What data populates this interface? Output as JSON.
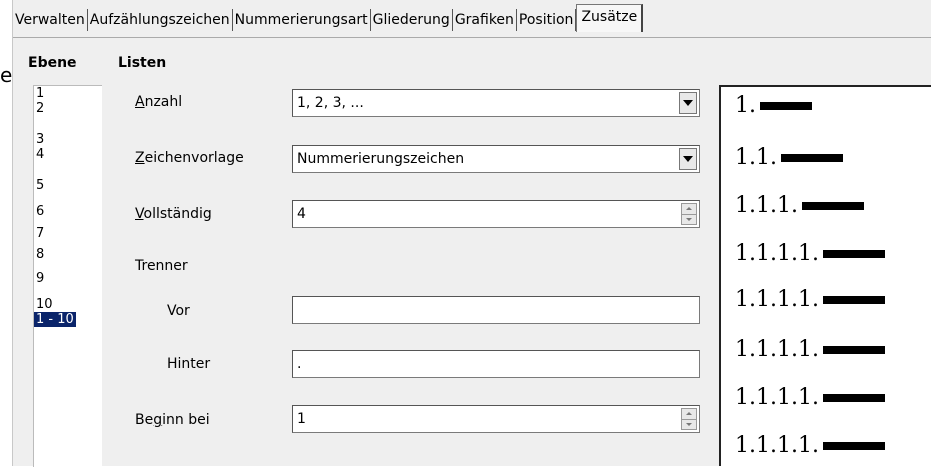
{
  "tabs": [
    {
      "label": "Verwalten",
      "active": false
    },
    {
      "label": "Aufzählungszeichen",
      "active": false
    },
    {
      "label": "Nummerierungsart",
      "active": false
    },
    {
      "label": "Gliederung",
      "active": false
    },
    {
      "label": "Grafiken",
      "active": false
    },
    {
      "label": "Position",
      "active": false
    },
    {
      "label": "Zusätze",
      "active": true
    }
  ],
  "cut_text": "e",
  "ebene": {
    "heading": "Ebene",
    "levels": [
      "1",
      "2",
      "3",
      "4",
      "5",
      "6",
      "7",
      "8",
      "9",
      "10",
      "1 - 10"
    ],
    "selected": "1 - 10"
  },
  "listen": {
    "heading": "Listen",
    "anzahl": {
      "label_u": "A",
      "label_rest": "nzahl",
      "value": "1, 2, 3, ..."
    },
    "zeichenvorlage": {
      "label_u": "Z",
      "label_rest": "eichenvorlage",
      "value": "Nummerierungszeichen"
    },
    "vollstaendig": {
      "label_u": "V",
      "label_rest": "ollständig",
      "value": "4"
    },
    "trenner": {
      "label": "Trenner"
    },
    "vor": {
      "label": "Vor",
      "value": ""
    },
    "hinter": {
      "label": "Hinter",
      "value": "."
    },
    "beginn": {
      "label_pre": "Be",
      "label_u": "g",
      "label_rest": "inn bei",
      "value": "1"
    }
  },
  "preview": {
    "rows": [
      "1.",
      "1.1.",
      "1.1.1.",
      "1.1.1.1.",
      "1.1.1.1.",
      "1.1.1.1.",
      "1.1.1.1.",
      "1.1.1.1."
    ]
  }
}
